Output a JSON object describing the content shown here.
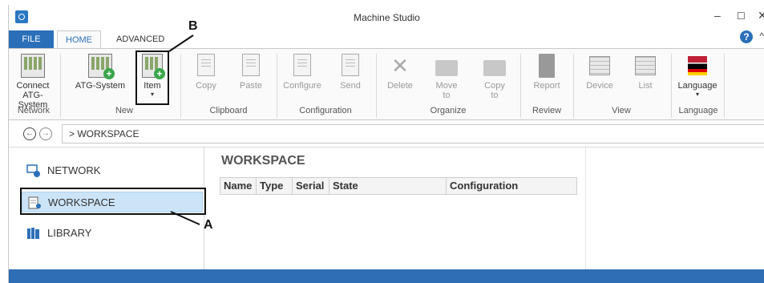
{
  "window": {
    "title": "Machine Studio",
    "minimize": "–",
    "maximize": "☐",
    "close": "✕"
  },
  "ribbon_tabs": {
    "file": "FILE",
    "home": "HOME",
    "advanced": "ADVANCED"
  },
  "ribbon": {
    "connect": {
      "label1": "Connect",
      "label2": "ATG-System"
    },
    "atg_system": {
      "label": "ATG-System"
    },
    "item": {
      "label": "Item",
      "dropdown": "▾"
    },
    "copy": {
      "label": "Copy"
    },
    "paste": {
      "label": "Paste"
    },
    "configure": {
      "label": "Configure"
    },
    "send": {
      "label": "Send"
    },
    "delete": {
      "label": "Delete"
    },
    "move_to": {
      "label1": "Move",
      "label2": "to"
    },
    "copy_to": {
      "label1": "Copy",
      "label2": "to"
    },
    "report": {
      "label": "Report"
    },
    "device": {
      "label": "Device"
    },
    "list": {
      "label": "List"
    },
    "language": {
      "label": "Language",
      "dropdown": "▾"
    },
    "groups": {
      "network": "Network",
      "new": "New",
      "clipboard": "Clipboard",
      "configuration": "Configuration",
      "organize": "Organize",
      "review": "Review",
      "view": "View",
      "language": "Language"
    }
  },
  "annotations": {
    "a": "A",
    "b": "B"
  },
  "navigation": {
    "back": "←",
    "forward": "→",
    "path": "> WORKSPACE"
  },
  "sidebar": {
    "items": [
      {
        "label": "NETWORK"
      },
      {
        "label": "WORKSPACE"
      },
      {
        "label": "LIBRARY"
      }
    ]
  },
  "main": {
    "title": "WORKSPACE",
    "columns": [
      "Name",
      "Type",
      "Serial",
      "State",
      "Configuration"
    ]
  },
  "colors": {
    "accent": "#2b6fb8",
    "selection": "#cce4f7",
    "status_bar": "#2f6db5"
  }
}
